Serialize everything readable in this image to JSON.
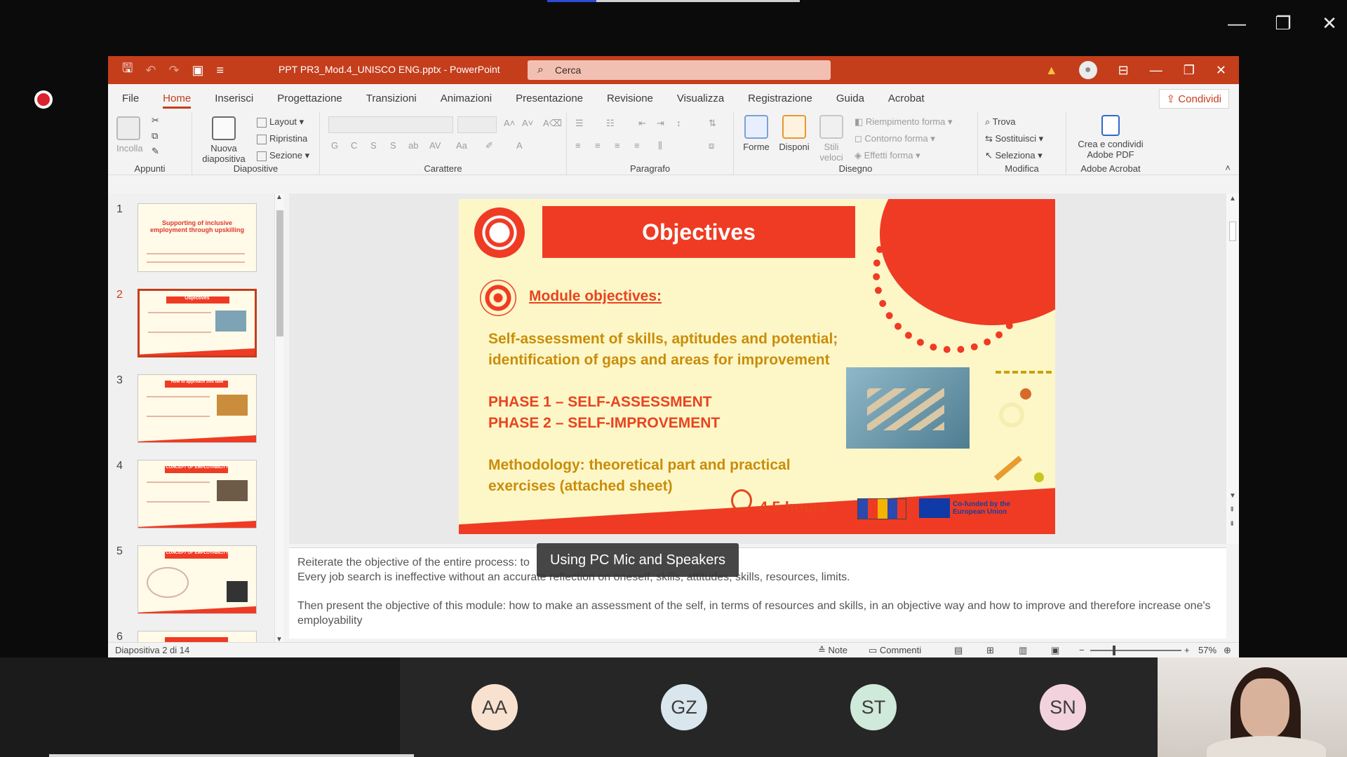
{
  "host": {
    "controls": [
      "—",
      "❐",
      "✕"
    ]
  },
  "ppt": {
    "doc_title": "PPT PR3_Mod.4_UNISCO ENG.pptx  -  PowerPoint",
    "search_placeholder": "Cerca",
    "menu": [
      "File",
      "Home",
      "Inserisci",
      "Progettazione",
      "Transizioni",
      "Animazioni",
      "Presentazione",
      "Revisione",
      "Visualizza",
      "Registrazione",
      "Guida",
      "Acrobat"
    ],
    "share_label": "Condividi",
    "ribbon": {
      "groups": {
        "appunti": "Appunti",
        "diapositive": "Diapositive",
        "carattere": "Carattere",
        "paragrafo": "Paragrafo",
        "disegno": "Disegno",
        "modifica": "Modifica",
        "acrobat": "Adobe Acrobat"
      },
      "incolla": "Incolla",
      "nuova": "Nuova",
      "diapositiva": "diapositiva",
      "layout": "Layout",
      "ripristina": "Ripristina",
      "sezione": "Sezione",
      "forme": "Forme",
      "disponi": "Disponi",
      "stili": "Stili",
      "veloci": "veloci",
      "riempimento": "Riempimento forma",
      "contorno": "Contorno forma",
      "effetti": "Effetti forma",
      "trova": "Trova",
      "sostituisci": "Sostituisci",
      "seleziona": "Seleziona",
      "crea_line1": "Crea e condividi",
      "crea_line2": "Adobe PDF",
      "font_buttons": [
        "G",
        "C",
        "S",
        "S",
        "ab",
        "AV",
        "Aa"
      ]
    },
    "thumbnails": [
      {
        "num": "1",
        "title": "Supporting of inclusive employment through upskilling"
      },
      {
        "num": "2",
        "title": "Objectives"
      },
      {
        "num": "3",
        "title": "How to approach this task"
      },
      {
        "num": "4",
        "title": "CONCEPT OF EMPLOYABILITY"
      },
      {
        "num": "5",
        "title": "CONCEPT OF EMPLOYABILITY"
      },
      {
        "num": "6",
        "title": ""
      }
    ],
    "slide": {
      "title": "Objectives",
      "module_objectives": "Module objectives:",
      "line1": "Self-assessment of skills, aptitudes and potential;",
      "line2": "identification of gaps and areas for improvement",
      "phase1": "PHASE 1 – SELF-ASSESSMENT",
      "phase2": "PHASE 2 – SELF-IMPROVEMENT",
      "meth1": "Methodology: theoretical part and practical",
      "meth2": "exercises (attached sheet)",
      "hours": "4.5 hours",
      "eu_text": "Co-funded by the European Union"
    },
    "notes": {
      "p1_line1": "Reiterate the objective of the entire process: to",
      "p1_line2": "Every job search is ineffective without an accurate reflection on oneself, skills, attitudes, skills, resources, limits.",
      "p2": "Then present the objective of this module: how to make an assessment of the self, in terms of resources and skills, in an objective way and how to improve and therefore increase one's employability"
    },
    "status": {
      "slide_info": "Diapositiva 2 di 14",
      "note": "Note",
      "comments": "Commenti",
      "zoom": "57%"
    }
  },
  "tooltip": "Using PC Mic and Speakers",
  "participants": [
    {
      "initials": "AA",
      "color": "#f9e1cf"
    },
    {
      "initials": "GZ",
      "color": "#d9e6ee"
    },
    {
      "initials": "ST",
      "color": "#cfe9da"
    },
    {
      "initials": "SN",
      "color": "#f2d3dd"
    }
  ]
}
